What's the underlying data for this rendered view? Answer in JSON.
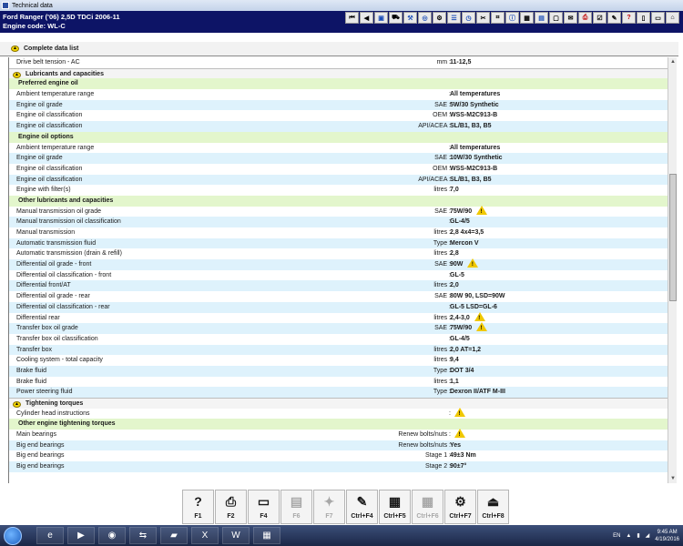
{
  "window": {
    "title": "Technical data"
  },
  "header": {
    "vehicle": "Ford   Ranger ('06) 2,5D TDCi 2006-11",
    "engine": "Engine code: WL-C"
  },
  "panel": {
    "title": "Complete data list"
  },
  "rows": [
    {
      "kind": "a",
      "label": "Drive belt tension - AC",
      "unit": "mm :",
      "value": "11-12,5"
    },
    {
      "kind": "sec",
      "label": "Lubricants and capacities"
    },
    {
      "kind": "sub",
      "label": "Preferred engine oil"
    },
    {
      "kind": "a",
      "label": "Ambient temperature range",
      "unit": ":",
      "value": "All temperatures"
    },
    {
      "kind": "b",
      "label": "Engine oil grade",
      "unit": "SAE :",
      "value": "5W/30 Synthetic"
    },
    {
      "kind": "a",
      "label": "Engine oil classification",
      "unit": "OEM :",
      "value": "WSS-M2C913-B"
    },
    {
      "kind": "b",
      "label": "Engine oil classification",
      "unit": "API/ACEA :",
      "value": "SL/B1, B3, B5"
    },
    {
      "kind": "sub",
      "label": "Engine oil options"
    },
    {
      "kind": "a",
      "label": "Ambient temperature range",
      "unit": ":",
      "value": "All temperatures"
    },
    {
      "kind": "b",
      "label": "Engine oil grade",
      "unit": "SAE :",
      "value": "10W/30 Synthetic"
    },
    {
      "kind": "a",
      "label": "Engine oil classification",
      "unit": "OEM :",
      "value": "WSS-M2C913-B"
    },
    {
      "kind": "b",
      "label": "Engine oil classification",
      "unit": "API/ACEA :",
      "value": "SL/B1, B3, B5"
    },
    {
      "kind": "a",
      "label": "Engine with filter(s)",
      "unit": "litres :",
      "value": "7,0"
    },
    {
      "kind": "sub",
      "label": "Other lubricants and capacities"
    },
    {
      "kind": "a",
      "label": "Manual transmission oil grade",
      "unit": "SAE :",
      "value": "75W/90",
      "warn": true
    },
    {
      "kind": "b",
      "label": "Manual transmission oil classification",
      "unit": ":",
      "value": "GL-4/5"
    },
    {
      "kind": "a",
      "label": "Manual transmission",
      "unit": "litres :",
      "value": "2,8 4x4=3,5"
    },
    {
      "kind": "b",
      "label": "Automatic transmission fluid",
      "unit": "Type :",
      "value": "Mercon V"
    },
    {
      "kind": "a",
      "label": "Automatic transmission (drain & refill)",
      "unit": "litres :",
      "value": "2,8"
    },
    {
      "kind": "b",
      "label": "Differential oil grade - front",
      "unit": "SAE :",
      "value": "90W",
      "warn": true
    },
    {
      "kind": "a",
      "label": "Differential oil classification - front",
      "unit": ":",
      "value": "GL-5"
    },
    {
      "kind": "b",
      "label": "Differential front/AT",
      "unit": "litres :",
      "value": "2,0"
    },
    {
      "kind": "a",
      "label": "Differential oil grade - rear",
      "unit": "SAE :",
      "value": "80W 90, LSD=90W"
    },
    {
      "kind": "b",
      "label": "Differential oil classification - rear",
      "unit": ":",
      "value": "GL-5 LSD=GL-6"
    },
    {
      "kind": "a",
      "label": "Differential rear",
      "unit": "litres :",
      "value": "2,4-3,0",
      "warn": true
    },
    {
      "kind": "b",
      "label": "Transfer box oil grade",
      "unit": "SAE :",
      "value": "75W/90",
      "warn": true
    },
    {
      "kind": "a",
      "label": "Transfer box oil classification",
      "unit": ":",
      "value": "GL-4/5"
    },
    {
      "kind": "b",
      "label": "Transfer box",
      "unit": "litres :",
      "value": "2,0  AT=1,2"
    },
    {
      "kind": "a",
      "label": "Cooling system - total capacity",
      "unit": "litres :",
      "value": "9,4"
    },
    {
      "kind": "b",
      "label": "Brake fluid",
      "unit": "Type :",
      "value": "DOT 3/4"
    },
    {
      "kind": "a",
      "label": "Brake fluid",
      "unit": "litres :",
      "value": "1,1"
    },
    {
      "kind": "b",
      "label": "Power steering fluid",
      "unit": "Type :",
      "value": "Dexron II/ATF M-III"
    },
    {
      "kind": "sec",
      "label": "Tightening torques"
    },
    {
      "kind": "a",
      "label": "Cylinder head instructions",
      "unit": ":",
      "value": "",
      "warn": true
    },
    {
      "kind": "sub",
      "label": "Other engine tightening torques"
    },
    {
      "kind": "a",
      "label": "Main bearings",
      "unit": "Renew bolts/nuts :",
      "value": "",
      "warn": true
    },
    {
      "kind": "b",
      "label": "Big end bearings",
      "unit": "Renew bolts/nuts :",
      "value": "Yes"
    },
    {
      "kind": "a",
      "label": "Big end bearings",
      "unit": "Stage 1 :",
      "value": "49±3 Nm"
    },
    {
      "kind": "b",
      "label": "Big end bearings",
      "unit": "Stage 2 :",
      "value": "90±7°"
    }
  ],
  "fkeys": [
    {
      "key": "F1",
      "icon": "?",
      "enabled": true
    },
    {
      "key": "F2",
      "icon": "⎙",
      "enabled": true
    },
    {
      "key": "F4",
      "icon": "▭",
      "enabled": true
    },
    {
      "key": "F6",
      "icon": "▤",
      "enabled": false
    },
    {
      "key": "F7",
      "icon": "✦",
      "enabled": false
    },
    {
      "key": "Ctrl+F4",
      "icon": "✎",
      "enabled": true
    },
    {
      "key": "Ctrl+F5",
      "icon": "▦",
      "enabled": true
    },
    {
      "key": "Ctrl+F6",
      "icon": "▦",
      "enabled": false
    },
    {
      "key": "Ctrl+F7",
      "icon": "⚙",
      "enabled": true
    },
    {
      "key": "Ctrl+F8",
      "icon": "⏏",
      "enabled": true
    }
  ],
  "taskbar": {
    "lang": "EN",
    "time": "9:45 AM",
    "date": "4/19/2016"
  }
}
